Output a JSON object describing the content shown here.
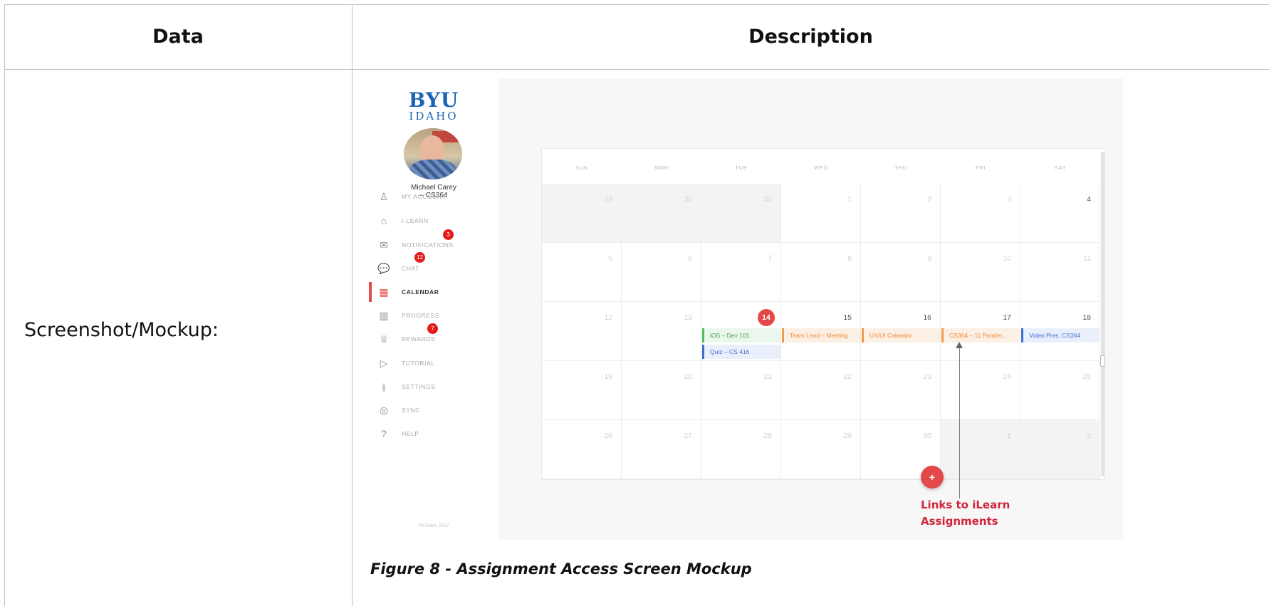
{
  "table": {
    "header_data": "Data",
    "header_description": "Description",
    "row_label": "Screenshot/Mockup:",
    "caption": "Figure 8 - Assignment Access Screen Mockup"
  },
  "mockup": {
    "logo_primary": "BYU",
    "logo_secondary": "IDAHO",
    "user_name": "Michael Carey\n– CS364",
    "nav": [
      {
        "label": "MY ACCOUNT",
        "icon": "user-icon",
        "glyph": "♙"
      },
      {
        "label": "I-LEARN",
        "icon": "home-icon",
        "glyph": "⌂"
      },
      {
        "label": "NOTIFICATIONS",
        "icon": "mail-icon",
        "glyph": "✉",
        "badge": "3"
      },
      {
        "label": "CHAT",
        "icon": "chat-bubble-icon",
        "glyph": "💬",
        "badge": "12"
      },
      {
        "label": "CALENDAR",
        "icon": "calendar-icon",
        "glyph": "▦",
        "active": true
      },
      {
        "label": "PROGRESS",
        "icon": "bar-chart-icon",
        "glyph": "▥"
      },
      {
        "label": "REWARDS",
        "icon": "trophy-icon",
        "glyph": "♕",
        "badge": "7"
      },
      {
        "label": "TUTORIAL",
        "icon": "play-video-icon",
        "glyph": "▷"
      },
      {
        "label": "SETTINGS",
        "icon": "sliders-icon",
        "glyph": "⫳"
      },
      {
        "label": "SYNC",
        "icon": "sync-icon",
        "glyph": "◎"
      },
      {
        "label": "HELP",
        "icon": "help-icon",
        "glyph": "?"
      }
    ],
    "copyright": "©CS364, 2017",
    "calendar": {
      "days_of_week": [
        "SUN",
        "MON",
        "TUE",
        "WED",
        "THU",
        "FRI",
        "SAT"
      ],
      "weeks": [
        [
          "29",
          "30",
          "31",
          "1",
          "2",
          "3",
          "4"
        ],
        [
          "5",
          "6",
          "7",
          "8",
          "9",
          "10",
          "11"
        ],
        [
          "12",
          "13",
          "14",
          "15",
          "16",
          "17",
          "18"
        ],
        [
          "19",
          "20",
          "21",
          "22",
          "23",
          "24",
          "25"
        ],
        [
          "26",
          "27",
          "28",
          "29",
          "30",
          "1",
          "2"
        ]
      ],
      "today": "14",
      "events": [
        {
          "title": "iOS – Dev 101",
          "color": "green"
        },
        {
          "title": "Quiz – CS 416",
          "color": "blue"
        },
        {
          "title": "Team Lead – Meeting",
          "color": "orange"
        },
        {
          "title": "UX/UI Calendar",
          "color": "orange"
        },
        {
          "title": "CS364 – 11 Ponder...",
          "color": "orange"
        },
        {
          "title": "Video Pres. CS364",
          "color": "blue"
        }
      ],
      "add_button": "+",
      "colors": {
        "accent": "#e54848",
        "green": "#4cbf59",
        "blue": "#3f6fd1",
        "orange": "#f2994a"
      }
    },
    "annotation": "Links to iLearn\nAssignments"
  }
}
